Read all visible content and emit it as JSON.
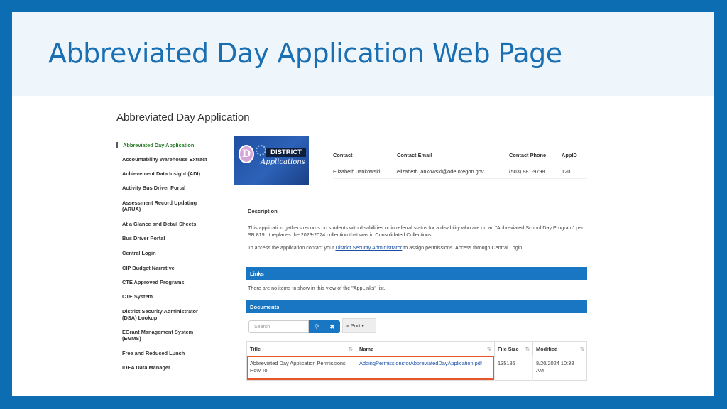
{
  "slide": {
    "title": "Abbreviated Day Application Web Page"
  },
  "page": {
    "title": "Abbreviated Day Application"
  },
  "sidebar": {
    "items": [
      {
        "label": "Abbreviated Day Application",
        "active": true
      },
      {
        "label": "Accountability Warehouse Extract"
      },
      {
        "label": "Achievement Data Insight (ADI)"
      },
      {
        "label": "Activity Bus Driver Portal"
      },
      {
        "label": "Assessment Record Updating (ARUA)"
      },
      {
        "label": "At a Glance and Detail Sheets"
      },
      {
        "label": "Bus Driver Portal"
      },
      {
        "label": "Central Login"
      },
      {
        "label": "CIP Budget Narrative"
      },
      {
        "label": "CTE Approved Programs"
      },
      {
        "label": "CTE System"
      },
      {
        "label": "District Security Administrator (DSA) Lookup"
      },
      {
        "label": "EGrant Management System (EGMS)"
      },
      {
        "label": "Free and Reduced Lunch"
      },
      {
        "label": "IDEA Data Manager"
      }
    ]
  },
  "logo": {
    "letter": "D",
    "line1": "DISTRICT",
    "line2": "Applications"
  },
  "contact": {
    "headers": {
      "contact": "Contact",
      "email": "Contact Email",
      "phone": "Contact Phone",
      "appid": "AppID"
    },
    "row": {
      "contact": "Elizabeth Jankowski",
      "email": "elizabeth.jankowski@ode.oregon.gov",
      "phone": "(503) 881-9798",
      "appid": "120"
    }
  },
  "description": {
    "heading": "Description",
    "text1": "This application gathers records on students with disabilities or in referral status for a disability who are on an \"Abbreviated School Day Program\" per SB 819. It replaces the 2023-2024 collection that was in Consolidated Collections.",
    "text2_before": "To access the application contact your ",
    "text2_link": "District Security Administrator",
    "text2_after": " to assign permissions. Access through Central Login."
  },
  "links": {
    "heading": "Links",
    "empty_text": "There are no items to show in this view of the \"AppLinks\" list."
  },
  "documents": {
    "heading": "Documents",
    "search_placeholder": "Search",
    "sort_label": "Sort",
    "columns": {
      "title": "Title",
      "name": "Name",
      "size": "File Size",
      "modified": "Modified"
    },
    "rows": [
      {
        "title": "Abbreviated Day Application Permissions How To",
        "name": "AddingPermissionsforAbbreviatedDayApplication.pdf",
        "size": "135186",
        "modified": "8/20/2024 10:38 AM"
      }
    ]
  },
  "icons": {
    "search": "search-icon",
    "clear": "close-icon",
    "sort": "sort-icon"
  },
  "colors": {
    "frame": "#0c6db3",
    "title": "#1a6fb3",
    "bar": "#1976c2",
    "highlight": "#e8552b",
    "active_item": "#2a7a2a"
  }
}
